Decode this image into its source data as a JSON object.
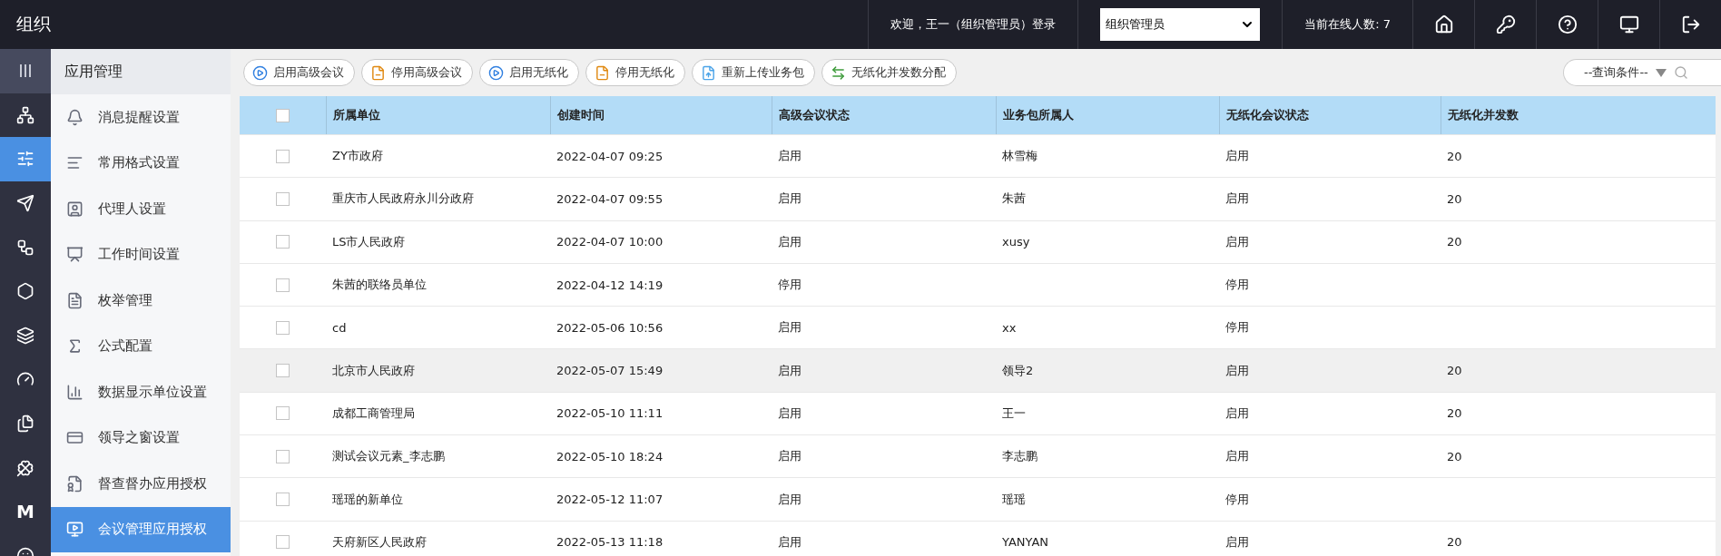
{
  "header": {
    "title": "组织",
    "welcome": "欢迎，王一（组织管理员）登录",
    "role_select": {
      "value": "组织管理员"
    },
    "online": "当前在线人数: 7"
  },
  "rail": [
    {
      "selected": false
    },
    {
      "selected": false
    },
    {
      "selected": true
    },
    {
      "selected": false
    },
    {
      "selected": false
    },
    {
      "selected": false
    },
    {
      "selected": false
    },
    {
      "selected": false
    },
    {
      "selected": false
    },
    {
      "selected": false
    },
    {
      "selected": false,
      "glyph": "M"
    },
    {
      "selected": false
    }
  ],
  "sidebar": {
    "title": "应用管理",
    "items": [
      {
        "label": "消息提醒设置",
        "selected": false
      },
      {
        "label": "常用格式设置",
        "selected": false
      },
      {
        "label": "代理人设置",
        "selected": false
      },
      {
        "label": "工作时间设置",
        "selected": false
      },
      {
        "label": "枚举管理",
        "selected": false
      },
      {
        "label": "公式配置",
        "selected": false
      },
      {
        "label": "数据显示单位设置",
        "selected": false
      },
      {
        "label": "领导之窗设置",
        "selected": false
      },
      {
        "label": "督查督办应用授权",
        "selected": false
      },
      {
        "label": "会议管理应用授权",
        "selected": true
      }
    ]
  },
  "toolbar": {
    "buttons": [
      {
        "label": "启用高级会议",
        "kind": "enable"
      },
      {
        "label": "停用高级会议",
        "kind": "disable"
      },
      {
        "label": "启用无纸化",
        "kind": "enable"
      },
      {
        "label": "停用无纸化",
        "kind": "disable"
      },
      {
        "label": "重新上传业务包",
        "kind": "upload"
      },
      {
        "label": "无纸化并发数分配",
        "kind": "allocate"
      }
    ],
    "query": {
      "placeholder": "--查询条件--"
    }
  },
  "table": {
    "header_checked": false,
    "columns": [
      "所属单位",
      "创建时间",
      "高级会议状态",
      "业务包所属人",
      "无纸化会议状态",
      "无纸化并发数"
    ],
    "rows": [
      {
        "checked": false,
        "highlighted": false,
        "cells": [
          "ZY市政府",
          "2022-04-07 09:25",
          "启用",
          "林雪梅",
          "启用",
          "20"
        ]
      },
      {
        "checked": false,
        "highlighted": false,
        "cells": [
          "重庆市人民政府永川分政府",
          "2022-04-07 09:55",
          "启用",
          "朱茜",
          "启用",
          "20"
        ]
      },
      {
        "checked": false,
        "highlighted": false,
        "cells": [
          "LS市人民政府",
          "2022-04-07 10:00",
          "启用",
          "xusy",
          "启用",
          "20"
        ]
      },
      {
        "checked": false,
        "highlighted": false,
        "cells": [
          "朱茜的联络员单位",
          "2022-04-12 14:19",
          "停用",
          "",
          "停用",
          ""
        ]
      },
      {
        "checked": false,
        "highlighted": false,
        "cells": [
          "cd",
          "2022-05-06 10:56",
          "启用",
          "xx",
          "停用",
          ""
        ]
      },
      {
        "checked": false,
        "highlighted": true,
        "cells": [
          "北京市人民政府",
          "2022-05-07 15:49",
          "启用",
          "领导2",
          "启用",
          "20"
        ]
      },
      {
        "checked": false,
        "highlighted": false,
        "cells": [
          "成都工商管理局",
          "2022-05-10 11:11",
          "启用",
          "王一",
          "启用",
          "20"
        ]
      },
      {
        "checked": false,
        "highlighted": false,
        "cells": [
          "测试会议元素_李志鹏",
          "2022-05-10 18:24",
          "启用",
          "李志鹏",
          "启用",
          "20"
        ]
      },
      {
        "checked": false,
        "highlighted": false,
        "cells": [
          "瑶瑶的新单位",
          "2022-05-12 11:07",
          "启用",
          "瑶瑶",
          "停用",
          ""
        ]
      },
      {
        "checked": false,
        "highlighted": false,
        "cells": [
          "天府新区人民政府",
          "2022-05-13 11:18",
          "启用",
          "YANYAN",
          "启用",
          "20"
        ]
      }
    ]
  }
}
